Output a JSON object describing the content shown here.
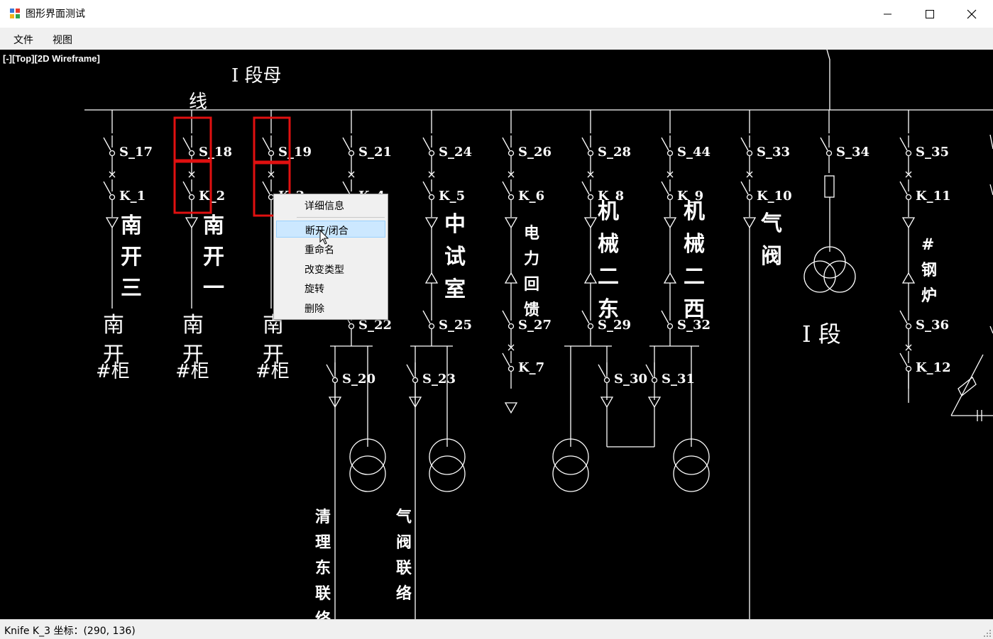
{
  "window": {
    "title": "图形界面测试"
  },
  "menu": {
    "file": "文件",
    "view": "视图"
  },
  "viewport": {
    "label": "[-][Top][2D Wireframe]"
  },
  "diagram": {
    "bus_label_1": "I 段母",
    "bus_label_2": "线",
    "switches_top": [
      "S_17",
      "S_18",
      "S_19",
      "S_21",
      "S_24",
      "S_26",
      "S_28",
      "S_44",
      "S_33",
      "S_34",
      "S_35"
    ],
    "knives": [
      "K_1",
      "K_2",
      "K_3",
      "K_4",
      "K_5",
      "K_6",
      "K_8",
      "K_9",
      "K_10",
      "K_11"
    ],
    "switches_mid": [
      "S_22",
      "S_25",
      "S_27",
      "S_29",
      "S_32",
      "S_36"
    ],
    "knives_low": [
      "K_7",
      "K_12"
    ],
    "switches_low": [
      "S_20",
      "S_23",
      "S_30",
      "S_31"
    ],
    "feeder_names": [
      "南开三",
      "南开一",
      "中试室",
      "电力回馈",
      "机械二东",
      "机械二西",
      "气阀",
      "#钢炉"
    ],
    "cabinet_lines": [
      "南",
      "开",
      "#柜"
    ],
    "section_label": "I 段",
    "bottom_labels": [
      "清理东联络",
      "气阀联络"
    ]
  },
  "context_menu": {
    "items": [
      "详细信息",
      "断开/闭合",
      "重命名",
      "改变类型",
      "旋转",
      "删除"
    ],
    "highlighted": "断开/闭合"
  },
  "status": {
    "text": "Knife K_3 坐标：(290, 136)"
  },
  "colors": {
    "canvas_bg": "#000000",
    "line": "#ffffff",
    "selection": "#e01010",
    "highlight": "#cce8ff"
  }
}
